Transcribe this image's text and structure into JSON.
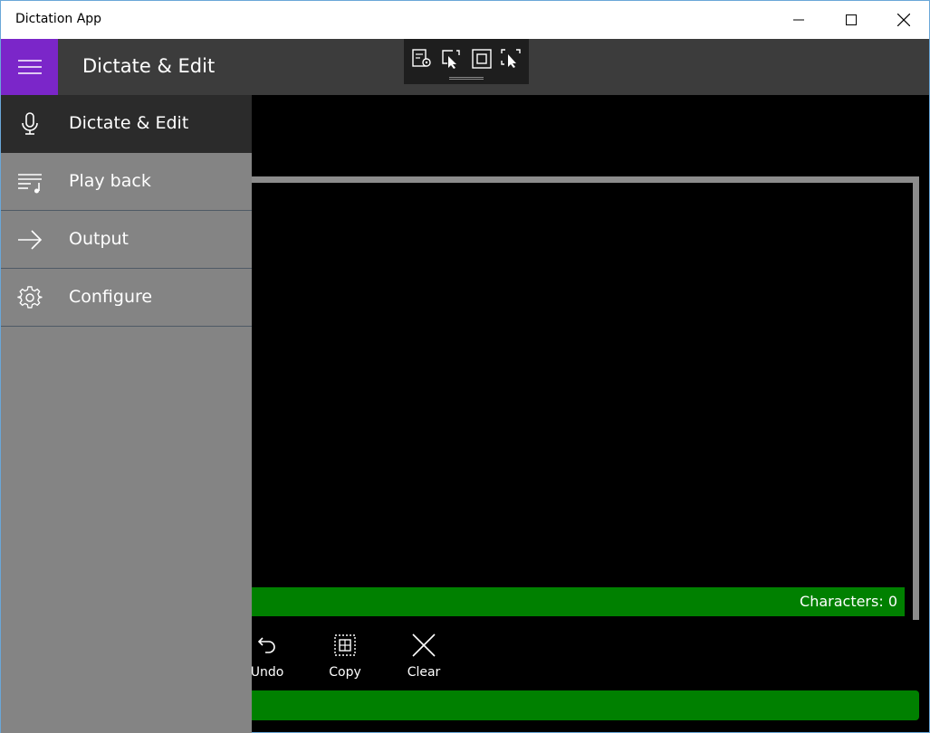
{
  "window": {
    "title": "Dictation App"
  },
  "header": {
    "title": "Dictate & Edit"
  },
  "nav": {
    "items": [
      {
        "label": "Dictate & Edit",
        "icon": "microphone-icon",
        "selected": true
      },
      {
        "label": "Play back",
        "icon": "playlist-icon",
        "selected": false
      },
      {
        "label": "Output",
        "icon": "arrow-right-icon",
        "selected": false
      },
      {
        "label": "Configure",
        "icon": "gear-icon",
        "selected": false
      }
    ]
  },
  "editor": {
    "character_count": "Characters: 0"
  },
  "commands": {
    "undo": "Undo",
    "copy": "Copy",
    "clear": "Clear"
  },
  "colors": {
    "accent": "#7b26c9",
    "status_green": "#008000",
    "nav_background": "#848484",
    "nav_selected": "#2b2b2b",
    "header_background": "#3c3c3c"
  }
}
